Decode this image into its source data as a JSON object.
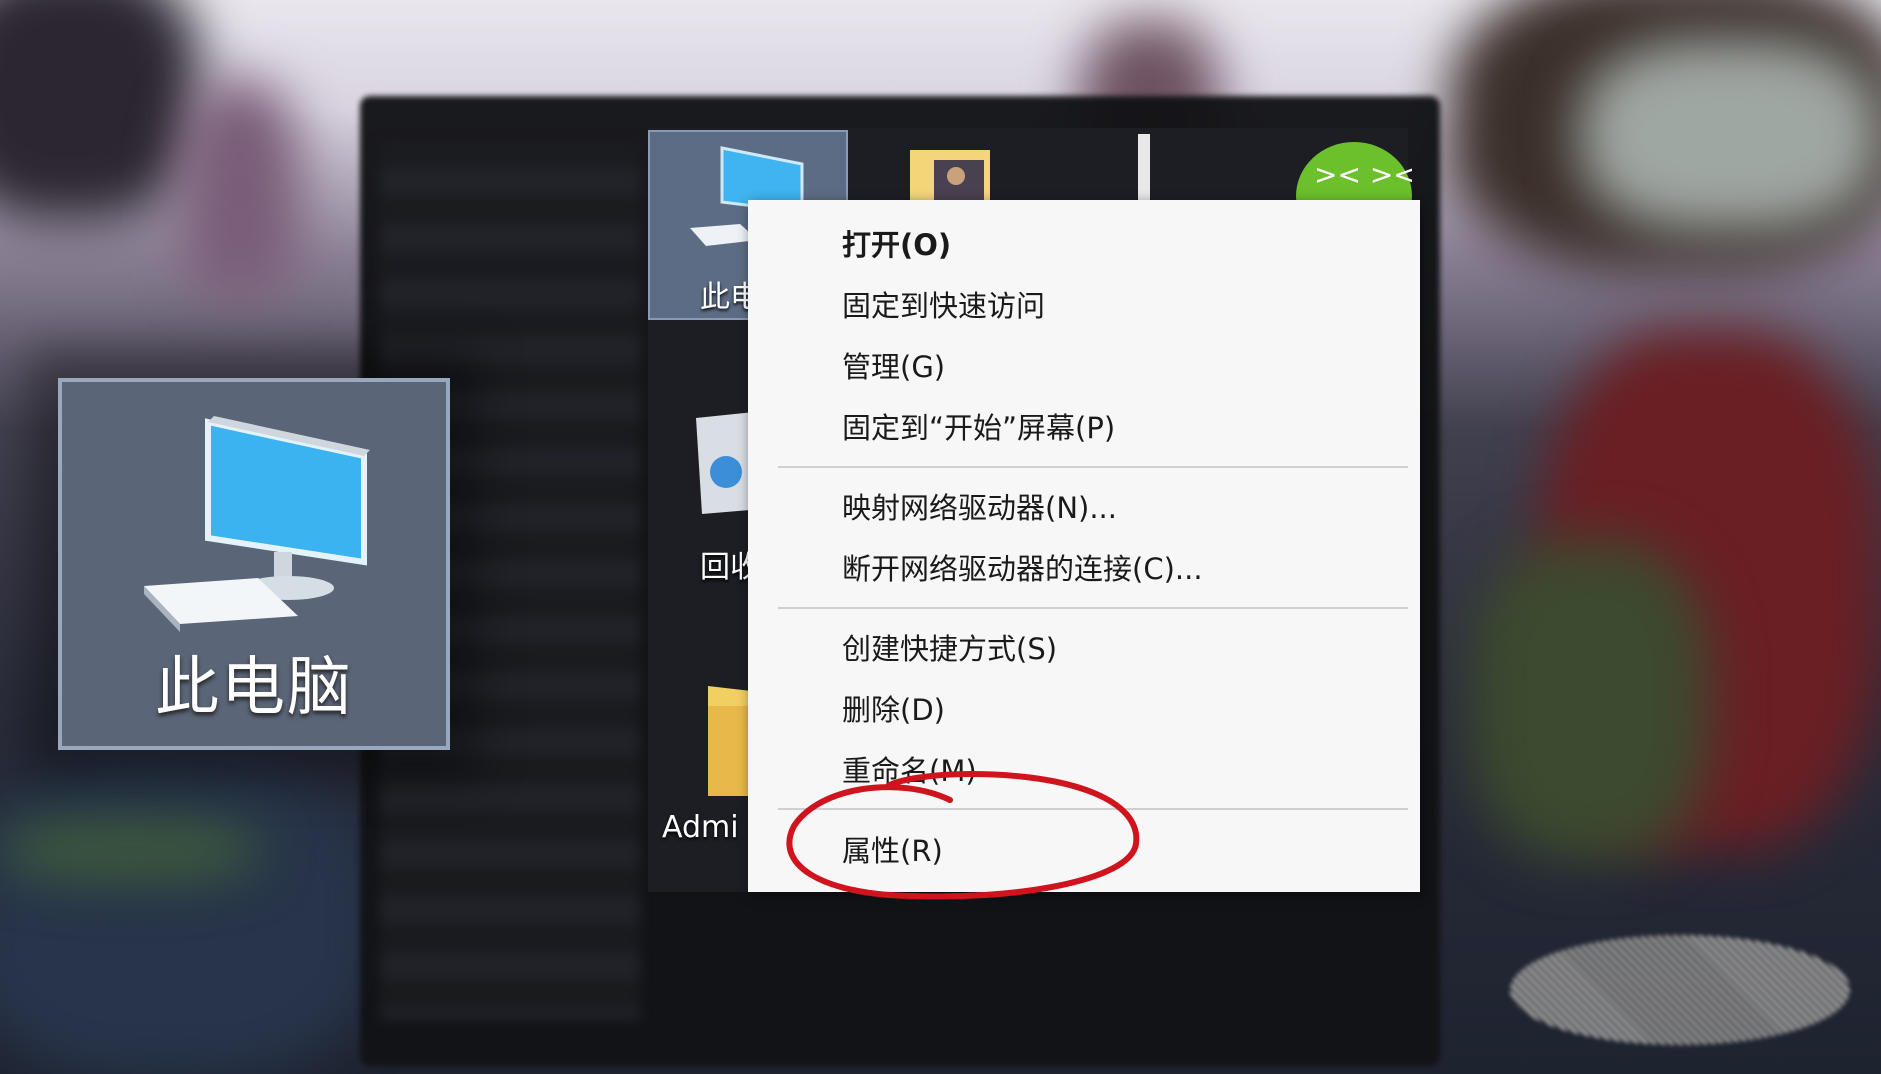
{
  "desktop": {
    "this_pc_label": "此电",
    "recycle_label": "回收",
    "admin_label": "Admi"
  },
  "zoom_card": {
    "label": "此电脑"
  },
  "context_menu": {
    "items": [
      {
        "label": "打开(O)",
        "bold": true
      },
      {
        "label": "固定到快速访问"
      },
      {
        "label": "管理(G)"
      },
      {
        "label": "固定到“开始”屏幕(P)"
      },
      {
        "label": "映射网络驱动器(N)..."
      },
      {
        "label": "断开网络驱动器的连接(C)..."
      },
      {
        "label": "创建快捷方式(S)"
      },
      {
        "label": "删除(D)"
      },
      {
        "label": "重命名(M)"
      },
      {
        "label": "属性(R)",
        "highlighted": true
      }
    ]
  },
  "annotation": {
    "color": "#d0141e",
    "target": "属性(R)"
  },
  "icons": {
    "monitor": "computer-monitor-icon",
    "recycle": "recycle-bin-icon",
    "folder": "folder-icon",
    "photo": "photo-folder-icon",
    "green_face": "green-face-icon"
  }
}
